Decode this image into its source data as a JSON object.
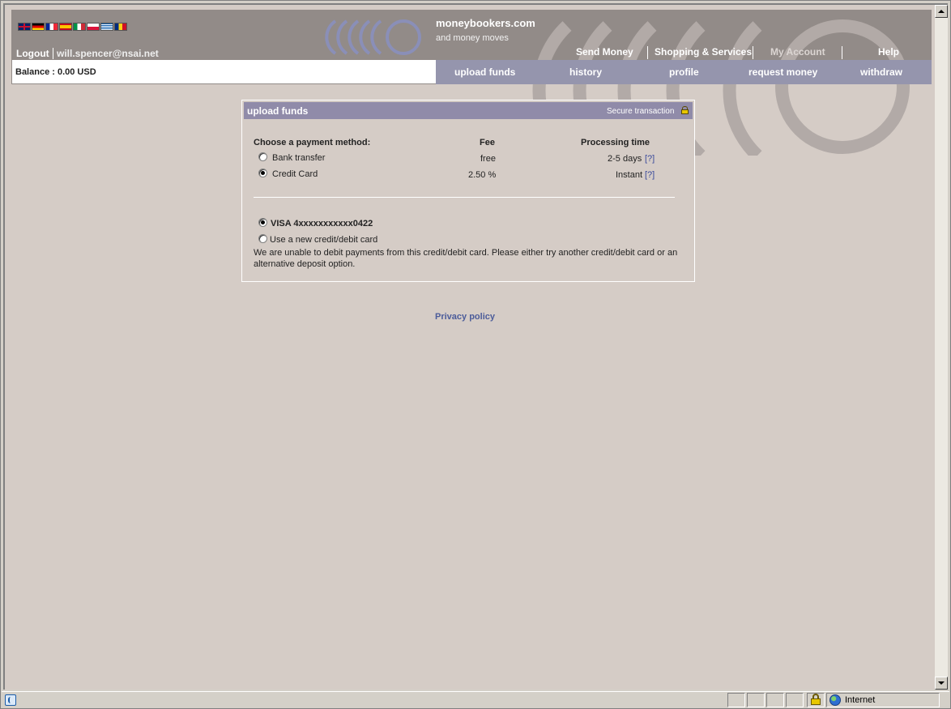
{
  "header": {
    "flags": [
      "en",
      "de",
      "fr",
      "es",
      "it",
      "pl",
      "gr",
      "ro"
    ],
    "logout_label": "Logout",
    "user_email": "will.spencer@nsai.net",
    "brand_name": "moneybookers.com",
    "brand_tagline": "and money moves",
    "top_nav": [
      "Send Money",
      "Shopping & Services",
      "My Account",
      "Help"
    ],
    "balance_text": "Balance : 0.00 USD",
    "tabs": [
      "upload funds",
      "history",
      "profile",
      "request money",
      "withdraw"
    ],
    "active_tab": "upload funds"
  },
  "panel": {
    "title": "upload funds",
    "secure_label": "Secure transaction",
    "choose_label": "Choose a payment method:",
    "fee_header": "Fee",
    "processing_header": "Processing time",
    "methods": [
      {
        "label": "Bank transfer",
        "fee": "free",
        "time": "2-5 days",
        "help": "[?]",
        "selected": false
      },
      {
        "label": "Credit Card",
        "fee": "2.50 %",
        "time": "Instant",
        "help": "[?]",
        "selected": true
      }
    ],
    "cards": [
      {
        "label": "VISA 4xxxxxxxxxxx0422",
        "selected": true
      },
      {
        "label": "Use a new credit/debit card",
        "selected": false
      }
    ],
    "error_message": "We are unable to debit payments from this credit/debit card. Please either try another credit/debit card or an alternative deposit option."
  },
  "footer": {
    "privacy_link": "Privacy policy"
  },
  "statusbar": {
    "zone_label": "Internet"
  },
  "colors": {
    "header_bg": "#928b88",
    "tab_bg": "#9595ad",
    "panel_header_bg": "#908ba9",
    "page_bg": "#d5ccc6",
    "link": "#3b4b9c"
  }
}
